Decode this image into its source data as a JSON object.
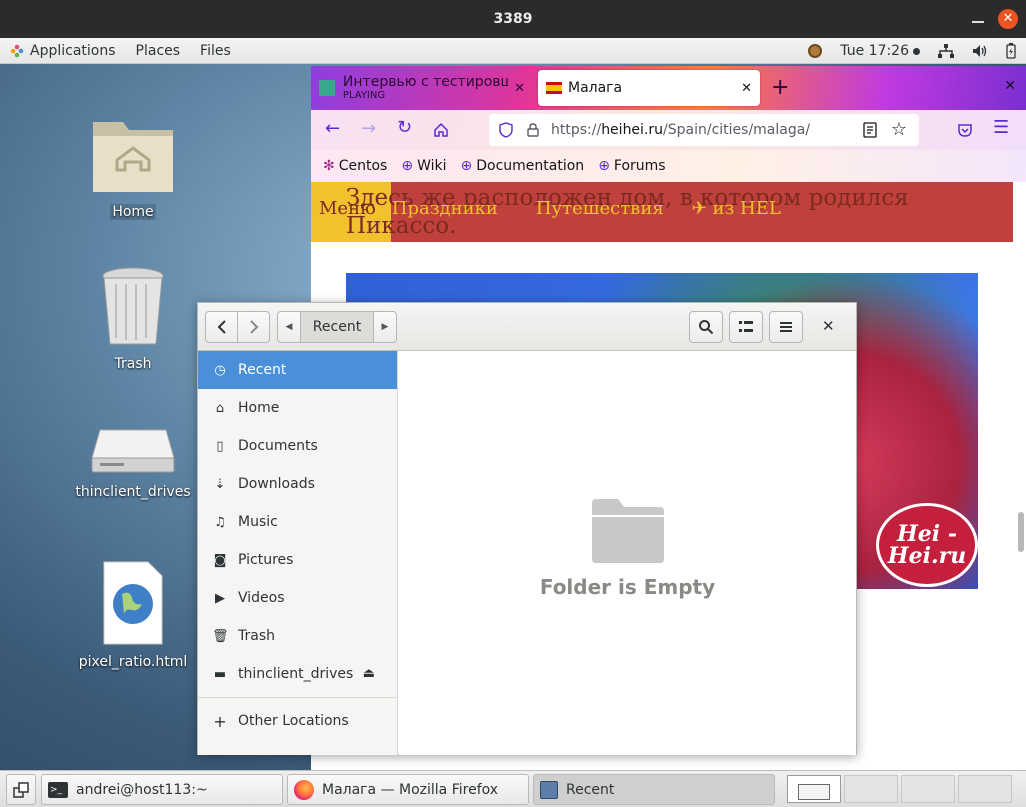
{
  "window": {
    "title": "3389"
  },
  "topbar": {
    "applications": "Applications",
    "places": "Places",
    "files": "Files",
    "clock": "Tue 17:26"
  },
  "desktop": {
    "icons": [
      {
        "label": "Home"
      },
      {
        "label": "Trash"
      },
      {
        "label": "thinclient_drives"
      },
      {
        "label": "pixel_ratio.html"
      }
    ]
  },
  "firefox": {
    "tabs": [
      {
        "title": "Интервью с тестировщик",
        "subtitle": "PLAYING"
      },
      {
        "title": "Малага"
      }
    ],
    "url_prefix": "https://",
    "url_host": "heihei.ru",
    "url_path": "/Spain/cities/malaga/",
    "bookmarks": [
      "Centos",
      "Wiki",
      "Documentation",
      "Forums"
    ],
    "page": {
      "text": "Здесь же расположен дом, в котором родился Пикассо.",
      "menu": [
        "Меню",
        "Праздники",
        "Путешествия",
        "✈ из HEL"
      ],
      "logo_line1": "Hei -",
      "logo_line2": "Hei.ru"
    }
  },
  "nautilus": {
    "location": "Recent",
    "sidebar": [
      {
        "label": "Recent",
        "icon": "clock-icon"
      },
      {
        "label": "Home",
        "icon": "home-icon"
      },
      {
        "label": "Documents",
        "icon": "document-icon"
      },
      {
        "label": "Downloads",
        "icon": "download-icon"
      },
      {
        "label": "Music",
        "icon": "music-icon"
      },
      {
        "label": "Pictures",
        "icon": "camera-icon"
      },
      {
        "label": "Videos",
        "icon": "video-icon"
      },
      {
        "label": "Trash",
        "icon": "trash-icon"
      },
      {
        "label": "thinclient_drives",
        "icon": "drive-icon"
      }
    ],
    "other_locations": "Other Locations",
    "empty_text": "Folder is Empty"
  },
  "panel": {
    "tasks": [
      {
        "label": "andrei@host113:~"
      },
      {
        "label": "Малага — Mozilla Firefox"
      },
      {
        "label": "Recent"
      }
    ]
  },
  "colors": {
    "accent": "#4a90d9",
    "close": "#e95420"
  }
}
